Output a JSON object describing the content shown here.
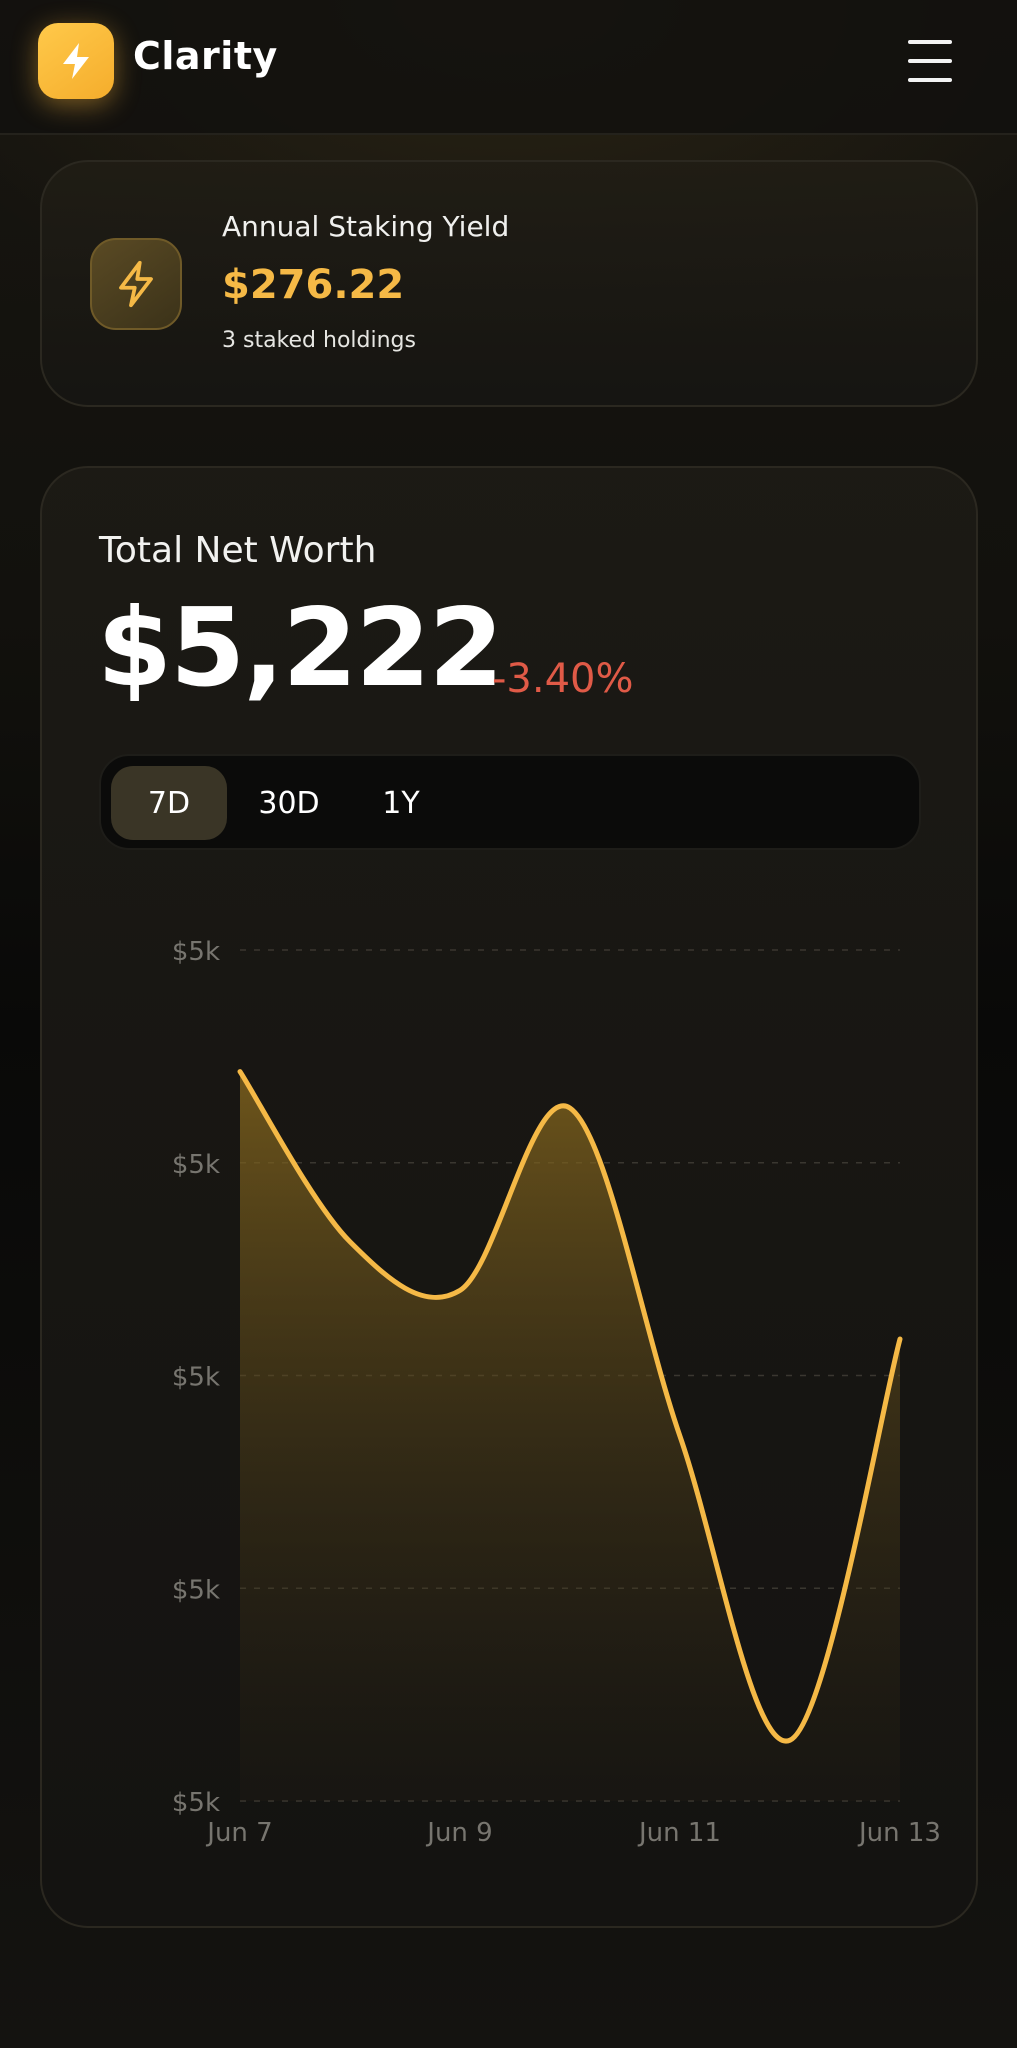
{
  "header": {
    "brand": "Clarity",
    "logo_icon": "bolt-icon",
    "menu_icon": "hamburger-menu-icon"
  },
  "staking": {
    "title": "Annual Staking Yield",
    "value": "$276.22",
    "subtitle": "3 staked holdings",
    "icon": "bolt-outline-icon"
  },
  "net_worth": {
    "title": "Total Net Worth",
    "value": "$5,222",
    "change": "-3.40%",
    "tabs": [
      {
        "label": "7D",
        "active": true
      },
      {
        "label": "30D",
        "active": false
      },
      {
        "label": "1Y",
        "active": false
      }
    ]
  },
  "colors": {
    "accent": "#f5b946",
    "negative": "#e05a47",
    "line": "#f5b946"
  },
  "chart_data": {
    "type": "area",
    "x": [
      "Jun 7",
      "Jun 8",
      "Jun 9",
      "Jun 10",
      "Jun 11",
      "Jun 12",
      "Jun 13"
    ],
    "values": [
      5290,
      5262,
      5254,
      5284,
      5230,
      5180,
      5246
    ],
    "y_tick_labels": [
      "$5k",
      "$5k",
      "$5k",
      "$5k",
      "$5k"
    ],
    "x_tick_labels": [
      "Jun 7",
      "Jun 9",
      "Jun 11",
      "Jun 13"
    ],
    "ylim": [
      5170,
      5310
    ],
    "grid": true
  }
}
